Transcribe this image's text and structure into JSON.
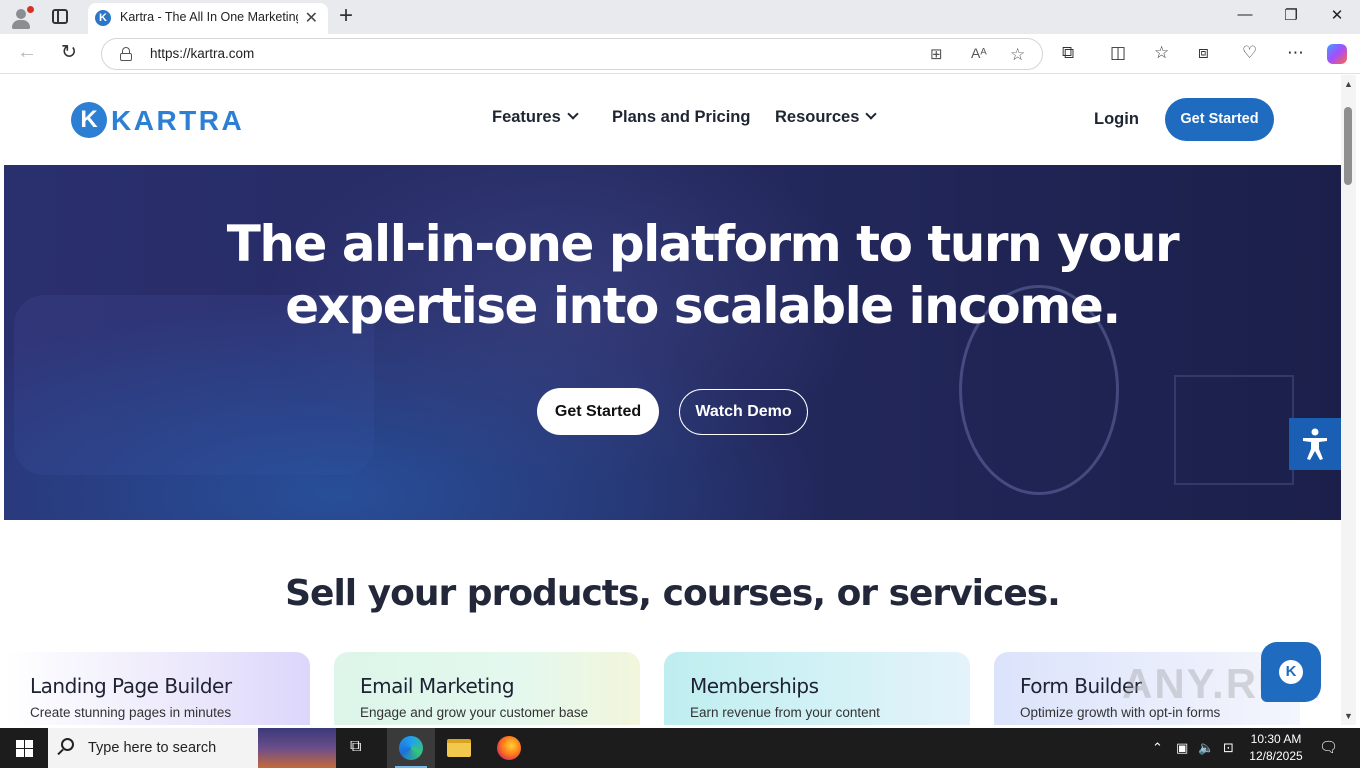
{
  "browser": {
    "tab_title": "Kartra - The All In One Marketing",
    "url": "https://kartra.com"
  },
  "site": {
    "logo_text": "KARTRA",
    "nav": [
      {
        "label": "Features"
      },
      {
        "label": "Plans and Pricing"
      },
      {
        "label": "Resources"
      }
    ],
    "login_label": "Login",
    "header_cta": "Get Started"
  },
  "hero": {
    "title_line1": "The all-in-one platform to turn your",
    "title_line2": "expertise into scalable income.",
    "primary_cta": "Get Started",
    "secondary_cta": "Watch Demo"
  },
  "section": {
    "heading": "Sell your products, courses, or services."
  },
  "cards": [
    {
      "title": "Landing Page Builder",
      "subtitle": "Create stunning pages in minutes"
    },
    {
      "title": "Email Marketing",
      "subtitle": "Engage and grow your customer base"
    },
    {
      "title": "Memberships",
      "subtitle": "Earn revenue from your content"
    },
    {
      "title": "Form Builder",
      "subtitle": "Optimize growth with opt-in forms"
    }
  ],
  "watermark": "ANY.RUN",
  "taskbar": {
    "search_placeholder": "Type here to search",
    "time": "10:30 AM",
    "date": "12/8/2025"
  },
  "colors": {
    "brand": "#2c7fd2",
    "cta": "#1f6bc0",
    "hero_bg": "#262b62"
  }
}
